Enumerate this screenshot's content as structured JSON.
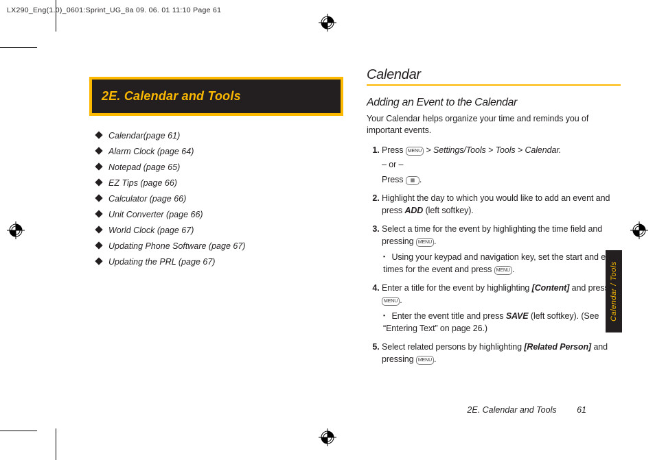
{
  "meta": {
    "header_line": "LX290_Eng(1.0)_0601:Sprint_UG_8a  09. 06. 01   11:10  Page 61"
  },
  "section_box": {
    "title": "2E.  Calendar and Tools"
  },
  "toc": [
    "Calendar(page 61)",
    "Alarm Clock (page 64)",
    "Notepad (page 65)",
    "EZ Tips (page 66)",
    "Calculator (page 66)",
    "Unit Converter (page 66)",
    "World Clock (page 67)",
    "Updating Phone Software (page 67)",
    "Updating the PRL (page 67)"
  ],
  "right": {
    "title": "Calendar",
    "subtitle": "Adding an Event to the Calendar",
    "intro": "Your Calendar helps organize your time and reminds you of important events.",
    "step1_a": "Press ",
    "step1_path": " > Settings/Tools > Tools > Calendar.",
    "step1_or": "– or –",
    "step1_b": "Press ",
    "step1_end": ".",
    "step2_a": "Highlight the day to which you would like to add an event and press ",
    "step2_add": "ADD",
    "step2_b": " (left softkey).",
    "step3_a": "Select a time for the event by highlighting the time field and pressing ",
    "step3_end": ".",
    "step3_sub_a": "Using your keypad and navigation key, set the start and end times for the event and press ",
    "step3_sub_end": ".",
    "step4_a": "Enter a title for the event by highlighting ",
    "step4_content": "[Content]",
    "step4_b": " and pressing ",
    "step4_end": ".",
    "step4_sub_a": "Enter the event title and press ",
    "step4_save": "SAVE",
    "step4_sub_b": " (left softkey). (See “Entering Text” on page 26.)",
    "step5_a": "Select related persons by highlighting ",
    "step5_related": "[Related Person]",
    "step5_b": " and pressing ",
    "step5_end": "."
  },
  "side_tab": "Calendar / Tools",
  "footer": {
    "text": "2E. Calendar and Tools",
    "page": "61"
  },
  "icons": {
    "menu_key_glyph": "MENU",
    "cal_key_glyph": "▦"
  }
}
